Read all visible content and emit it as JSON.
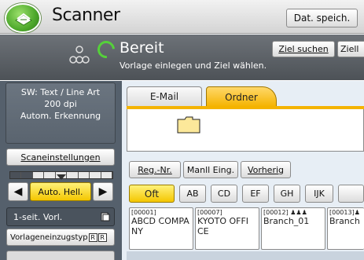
{
  "title_bar": {
    "app_title": "Scanner",
    "store_button": "Dat. speich."
  },
  "status": {
    "state": "Bereit",
    "message": "Vorlage einlegen und Ziel wählen.",
    "find_dest_button": "Ziel suchen",
    "partial_button": "Ziell"
  },
  "scan_info": {
    "line1": "SW: Text / Line Art",
    "line2": "200 dpi",
    "line3": "Autom. Erkennung"
  },
  "left_panel": {
    "scan_settings_button": "Scaneinstellungen",
    "density_button": "Auto. Hell.",
    "sided_label": "1-seit. Vorl.",
    "orig_feed_label": "Vorlageneinzugstyp",
    "orig_feed_icons": [
      "R",
      "R"
    ]
  },
  "tabs": [
    {
      "label": "E-Mail"
    },
    {
      "label": "Ordner"
    }
  ],
  "dest_buttons": {
    "reg_no": "Reg.-Nr.",
    "manual": "Manll Eing.",
    "previous": "Vorherig"
  },
  "index_tabs": [
    "Oft",
    "AB",
    "CD",
    "EF",
    "GH",
    "IJK",
    ""
  ],
  "entries": [
    {
      "num": "[00001]",
      "name1": "ABCD COMPA",
      "name2": "NY"
    },
    {
      "num": "[00007]",
      "name1": "KYOTO OFFI",
      "name2": "CE"
    },
    {
      "num": "[00012]",
      "name1": "Branch_01",
      "name2": ""
    },
    {
      "num": "[00013]",
      "name1": "Branch",
      "name2": ""
    }
  ],
  "colors": {
    "accent_yellow": "#f4c600",
    "folder_tab": "#f4b300",
    "ready_green": "#55d13a",
    "dark_band": "#5a5f65",
    "left_panel": "#55606c"
  }
}
